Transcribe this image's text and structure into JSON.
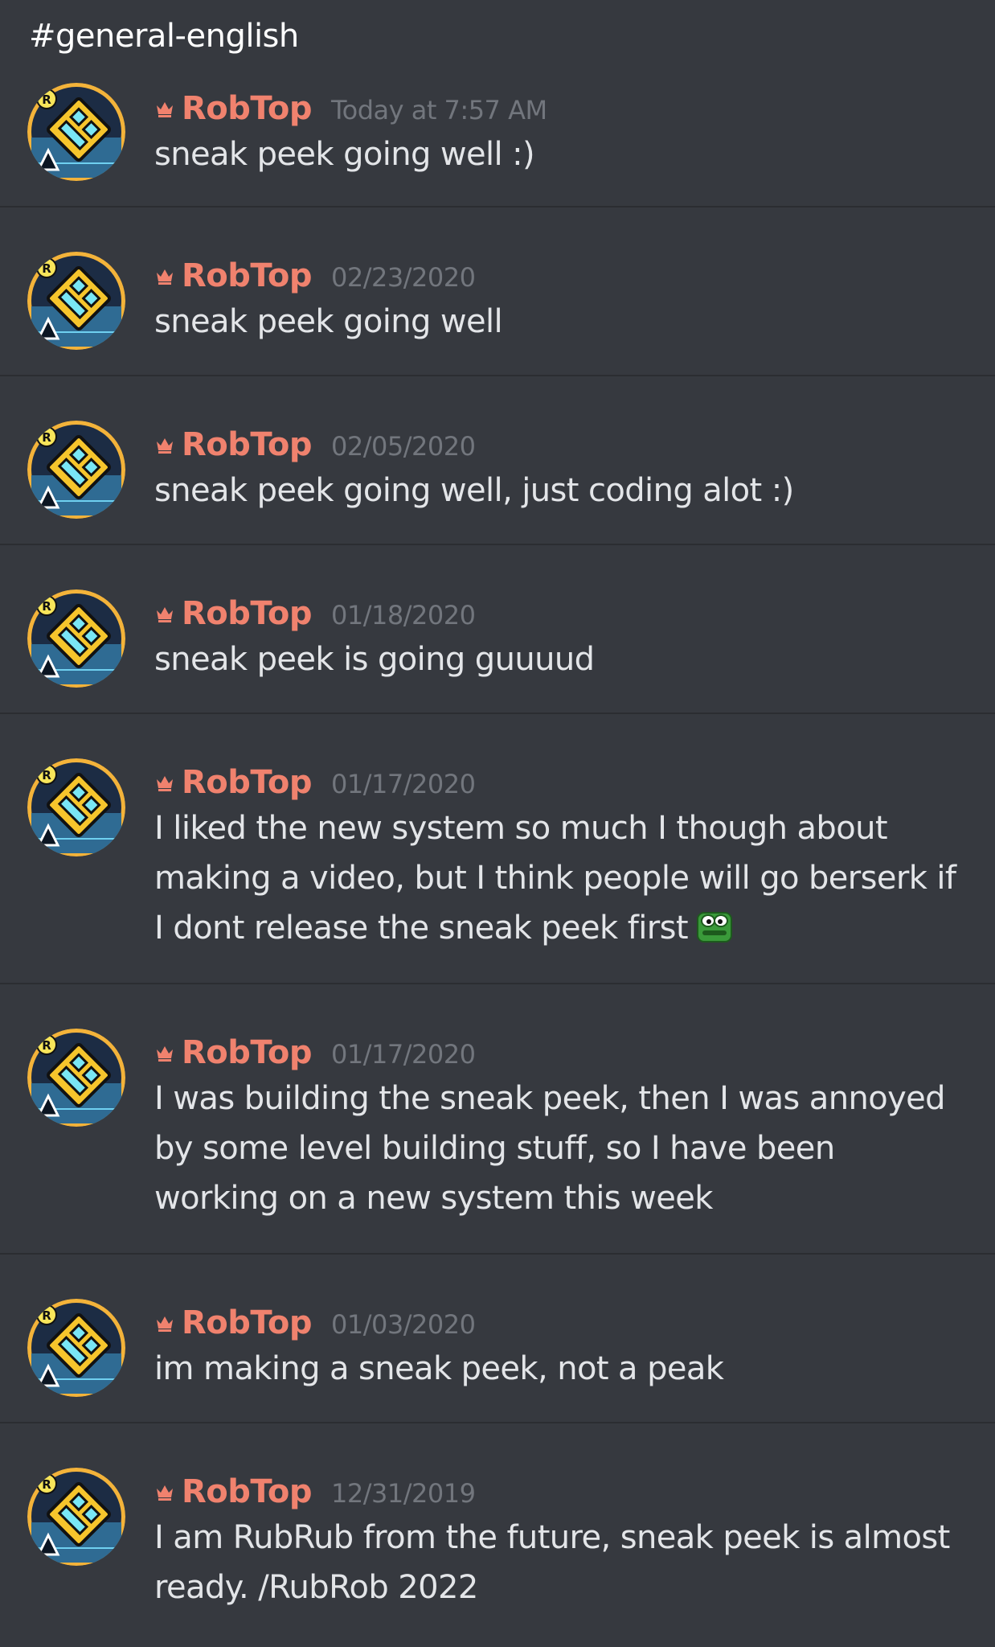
{
  "channel": {
    "name": "#general-english"
  },
  "colors": {
    "background": "#36393f",
    "author": "#f0826e",
    "timestamp": "#72767d",
    "text": "#e3e5e8",
    "divider": "#2b2d31"
  },
  "messages": [
    {
      "author": "RobTop",
      "timestamp": "Today at 7:57 AM",
      "lines": [
        "sneak peek going well :)"
      ],
      "icon": "robtop-avatar-icon"
    },
    {
      "author": "RobTop",
      "timestamp": "02/23/2020",
      "lines": [
        "sneak peek going well"
      ],
      "icon": "robtop-avatar-icon"
    },
    {
      "author": "RobTop",
      "timestamp": "02/05/2020",
      "lines": [
        "sneak peek going well, just coding alot :)"
      ],
      "icon": "robtop-avatar-icon"
    },
    {
      "author": "RobTop",
      "timestamp": "01/18/2020",
      "lines": [
        "sneak peek is going guuuud"
      ],
      "icon": "robtop-avatar-icon"
    },
    {
      "author": "RobTop",
      "timestamp": "01/17/2020",
      "lines": [
        "I liked the new system so much I though about",
        "making a video, but I think people will go berserk if",
        "I dont release the sneak peek first"
      ],
      "emoji": "green-frog-emoji-icon",
      "icon": "robtop-avatar-icon"
    },
    {
      "author": "RobTop",
      "timestamp": "01/17/2020",
      "lines": [
        "I was building the sneak peek, then I was annoyed",
        "by some level building stuff, so I have been",
        "working on a new system this week"
      ],
      "icon": "robtop-avatar-icon"
    },
    {
      "author": "RobTop",
      "timestamp": "01/03/2020",
      "lines": [
        "im making a sneak peek, not a peak"
      ],
      "icon": "robtop-avatar-icon"
    },
    {
      "author": "RobTop",
      "timestamp": "12/31/2019",
      "lines": [
        "I am RubRub from the future, sneak peek is almost",
        "ready. /RubRob 2022"
      ],
      "icon": "robtop-avatar-icon"
    }
  ]
}
